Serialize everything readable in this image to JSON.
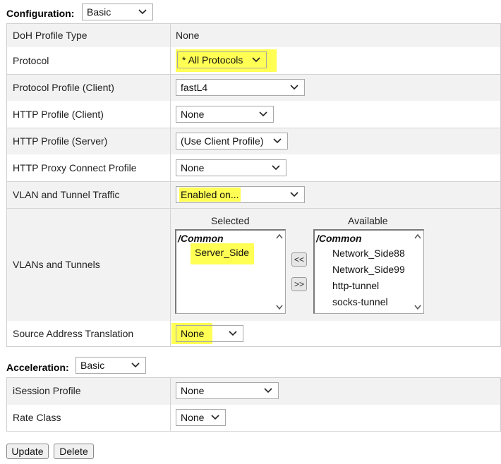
{
  "configuration": {
    "title": "Configuration:",
    "mode": "Basic",
    "rows": {
      "doh_profile_type": {
        "label": "DoH Profile Type",
        "value": "None"
      },
      "protocol": {
        "label": "Protocol",
        "value": "* All Protocols"
      },
      "protocol_profile_client": {
        "label": "Protocol Profile (Client)",
        "value": "fastL4"
      },
      "http_profile_client": {
        "label": "HTTP Profile (Client)",
        "value": "None"
      },
      "http_profile_server": {
        "label": "HTTP Profile (Server)",
        "value": "(Use Client Profile)"
      },
      "http_proxy_connect_profile": {
        "label": "HTTP Proxy Connect Profile",
        "value": "None"
      },
      "vlan_tunnel_traffic": {
        "label": "VLAN and Tunnel Traffic",
        "value": "Enabled on..."
      },
      "vlans_and_tunnels": {
        "label": "VLANs and Tunnels",
        "selected_header": "Selected",
        "available_header": "Available",
        "selected_group": "/Common",
        "selected_items": [
          "Server_Side"
        ],
        "available_group": "/Common",
        "available_items": [
          "Network_Side88",
          "Network_Side99",
          "http-tunnel",
          "socks-tunnel"
        ],
        "move_left_label": "<<",
        "move_right_label": ">>"
      },
      "source_address_translation": {
        "label": "Source Address Translation",
        "value": "None"
      }
    }
  },
  "acceleration": {
    "title": "Acceleration:",
    "mode": "Basic",
    "rows": {
      "isession_profile": {
        "label": "iSession Profile",
        "value": "None"
      },
      "rate_class": {
        "label": "Rate Class",
        "value": "None"
      }
    }
  },
  "buttons": {
    "update": "Update",
    "delete": "Delete"
  },
  "colors": {
    "highlight": "#ffff54",
    "panel": "#f2f2f2",
    "border": "#d4d4d4"
  },
  "icons": {
    "dropdown": "chevron-down-icon",
    "scroll_up": "scroll-up-arrow-icon",
    "scroll_down": "scroll-down-arrow-icon"
  }
}
